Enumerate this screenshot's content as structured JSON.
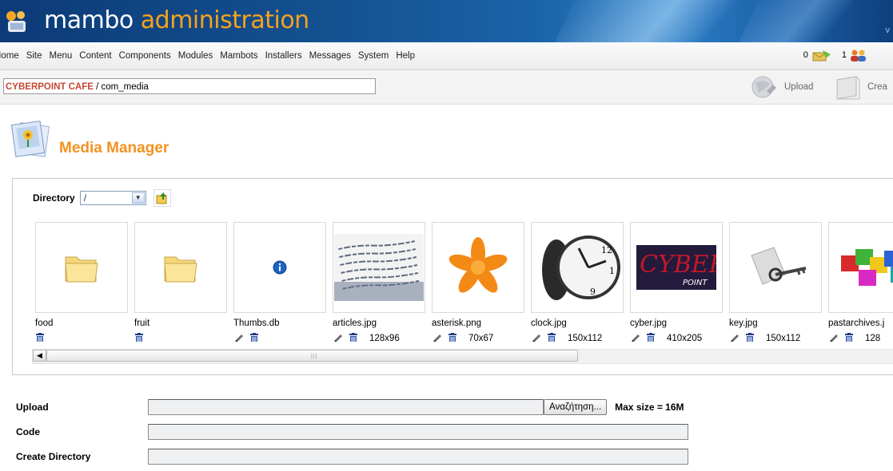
{
  "header": {
    "title_part1": "mambo",
    "title_part2": "administration",
    "version_fragment": "v"
  },
  "menu": {
    "items": [
      "Home",
      "Site",
      "Menu",
      "Content",
      "Components",
      "Modules",
      "Mambots",
      "Installers",
      "Messages",
      "System",
      "Help"
    ]
  },
  "stats": {
    "messages_count": "0",
    "users_count": "1"
  },
  "pathway": {
    "site": "CYBERPOINT CAFE",
    "separator": " / ",
    "component": "com_media"
  },
  "toolbar": {
    "upload_label": "Upload",
    "create_label": "Crea"
  },
  "page": {
    "title": "Media Manager"
  },
  "directory": {
    "label": "Directory",
    "selected": "/"
  },
  "files": [
    {
      "name": "food",
      "kind": "folder",
      "dims": ""
    },
    {
      "name": "fruit",
      "kind": "folder",
      "dims": ""
    },
    {
      "name": "Thumbs.db",
      "kind": "file",
      "dims": ""
    },
    {
      "name": "articles.jpg",
      "kind": "image",
      "dims": "128x96"
    },
    {
      "name": "asterisk.png",
      "kind": "image",
      "dims": "70x67"
    },
    {
      "name": "clock.jpg",
      "kind": "image",
      "dims": "150x112"
    },
    {
      "name": "cyber.jpg",
      "kind": "image",
      "dims": "410x205"
    },
    {
      "name": "key.jpg",
      "kind": "image",
      "dims": "150x112"
    },
    {
      "name": "pastarchives.j",
      "kind": "image",
      "dims": "128"
    }
  ],
  "cyber_image_text": {
    "big": "CYBER",
    "small": "POINT"
  },
  "form": {
    "upload_label": "Upload",
    "browse_label": "Αναζήτηση...",
    "max_size": "Max size = 16M",
    "code_label": "Code",
    "create_dir_label": "Create Directory"
  },
  "colors": {
    "accent_orange": "#f39220",
    "site_red": "#c64934",
    "banner_blue": "#13508f"
  }
}
